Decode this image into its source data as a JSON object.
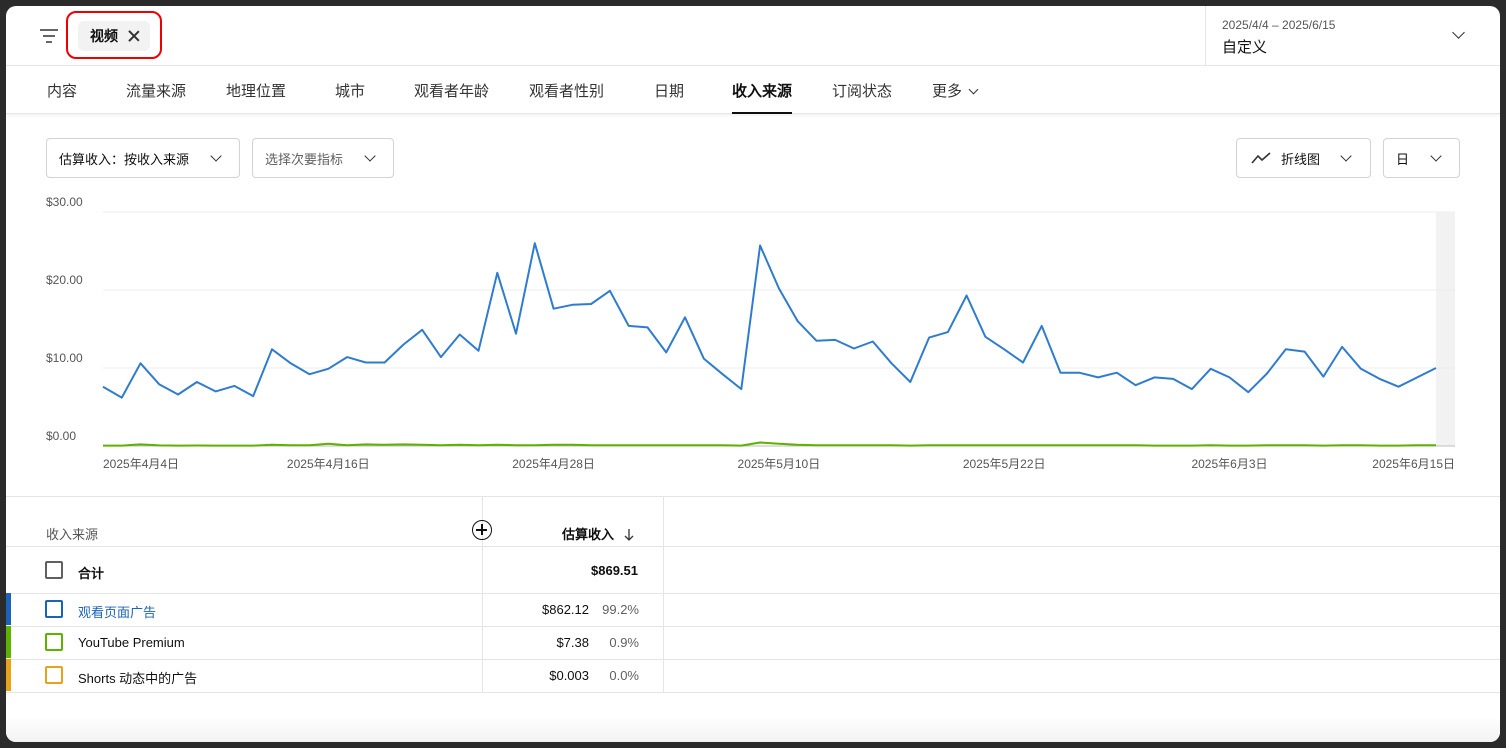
{
  "header": {
    "filter_chip": "视频",
    "date_range": "2025/4/4 – 2025/6/15",
    "date_label": "自定义"
  },
  "tabs": [
    {
      "label": "内容"
    },
    {
      "label": "流量来源"
    },
    {
      "label": "地理位置"
    },
    {
      "label": "城市"
    },
    {
      "label": "观看者年龄"
    },
    {
      "label": "观看者性别"
    },
    {
      "label": "日期"
    },
    {
      "label": "收入来源",
      "active": true
    },
    {
      "label": "订阅状态"
    },
    {
      "label": "更多"
    }
  ],
  "controls": {
    "primary_metric": "估算收入：按收入来源",
    "secondary_metric_placeholder": "选择次要指标",
    "chart_type": "折线图",
    "granularity": "日"
  },
  "chart_data": {
    "type": "line",
    "ylim": [
      0,
      30
    ],
    "y_ticks": [
      "$0.00",
      "$10.00",
      "$20.00",
      "$30.00"
    ],
    "x_ticks": [
      "2025年4月4日",
      "2025年4月16日",
      "2025年4月28日",
      "2025年5月10日",
      "2025年5月22日",
      "2025年6月3日",
      "2025年6月15日"
    ],
    "x_start": "2025-04-04",
    "x_end": "2025-06-15",
    "series": [
      {
        "name": "观看页面广告",
        "color": "#2f7ccf",
        "values": [
          7.6,
          6.2,
          10.6,
          7.9,
          6.6,
          8.2,
          7.0,
          7.7,
          6.4,
          12.4,
          10.6,
          9.2,
          9.9,
          11.4,
          10.7,
          10.7,
          13.0,
          14.9,
          11.4,
          14.3,
          12.2,
          22.2,
          14.4,
          26.0,
          17.6,
          18.1,
          18.2,
          19.9,
          15.4,
          15.2,
          12.0,
          16.5,
          11.2,
          9.2,
          7.3,
          25.7,
          20.2,
          16.0,
          13.5,
          13.6,
          12.5,
          13.4,
          10.6,
          8.2,
          13.9,
          14.6,
          19.3,
          14.0,
          12.4,
          10.7,
          15.4,
          9.4,
          9.4,
          8.8,
          9.4,
          7.8,
          8.8,
          8.6,
          7.3,
          9.9,
          8.8,
          6.9,
          9.3,
          12.4,
          12.1,
          8.9,
          12.7,
          9.9,
          8.6,
          7.6,
          8.8,
          10.0
        ]
      },
      {
        "name": "YouTube Premium",
        "color": "#5fb100",
        "values": [
          0.05,
          0.05,
          0.2,
          0.08,
          0.05,
          0.06,
          0.05,
          0.05,
          0.05,
          0.15,
          0.1,
          0.1,
          0.3,
          0.1,
          0.2,
          0.15,
          0.2,
          0.15,
          0.1,
          0.15,
          0.1,
          0.15,
          0.1,
          0.1,
          0.15,
          0.15,
          0.1,
          0.1,
          0.1,
          0.1,
          0.1,
          0.1,
          0.1,
          0.1,
          0.05,
          0.45,
          0.3,
          0.15,
          0.1,
          0.1,
          0.1,
          0.1,
          0.1,
          0.05,
          0.1,
          0.1,
          0.1,
          0.1,
          0.1,
          0.1,
          0.1,
          0.1,
          0.1,
          0.1,
          0.1,
          0.1,
          0.05,
          0.05,
          0.05,
          0.1,
          0.05,
          0.05,
          0.1,
          0.1,
          0.1,
          0.05,
          0.1,
          0.1,
          0.05,
          0.05,
          0.1,
          0.1
        ]
      }
    ]
  },
  "table": {
    "dimension_header": "收入来源",
    "metric_header": "估算收入",
    "total": {
      "label": "合计",
      "value": "$869.51"
    },
    "rows": [
      {
        "label": "观看页面广告",
        "value": "$862.12",
        "pct": "99.2%",
        "color": "#1c62b9"
      },
      {
        "label": "YouTube Premium",
        "value": "$7.38",
        "pct": "0.9%",
        "color": "#5fb100"
      },
      {
        "label": "Shorts 动态中的广告",
        "value": "$0.003",
        "pct": "0.0%",
        "color": "#e8a21a"
      }
    ]
  }
}
